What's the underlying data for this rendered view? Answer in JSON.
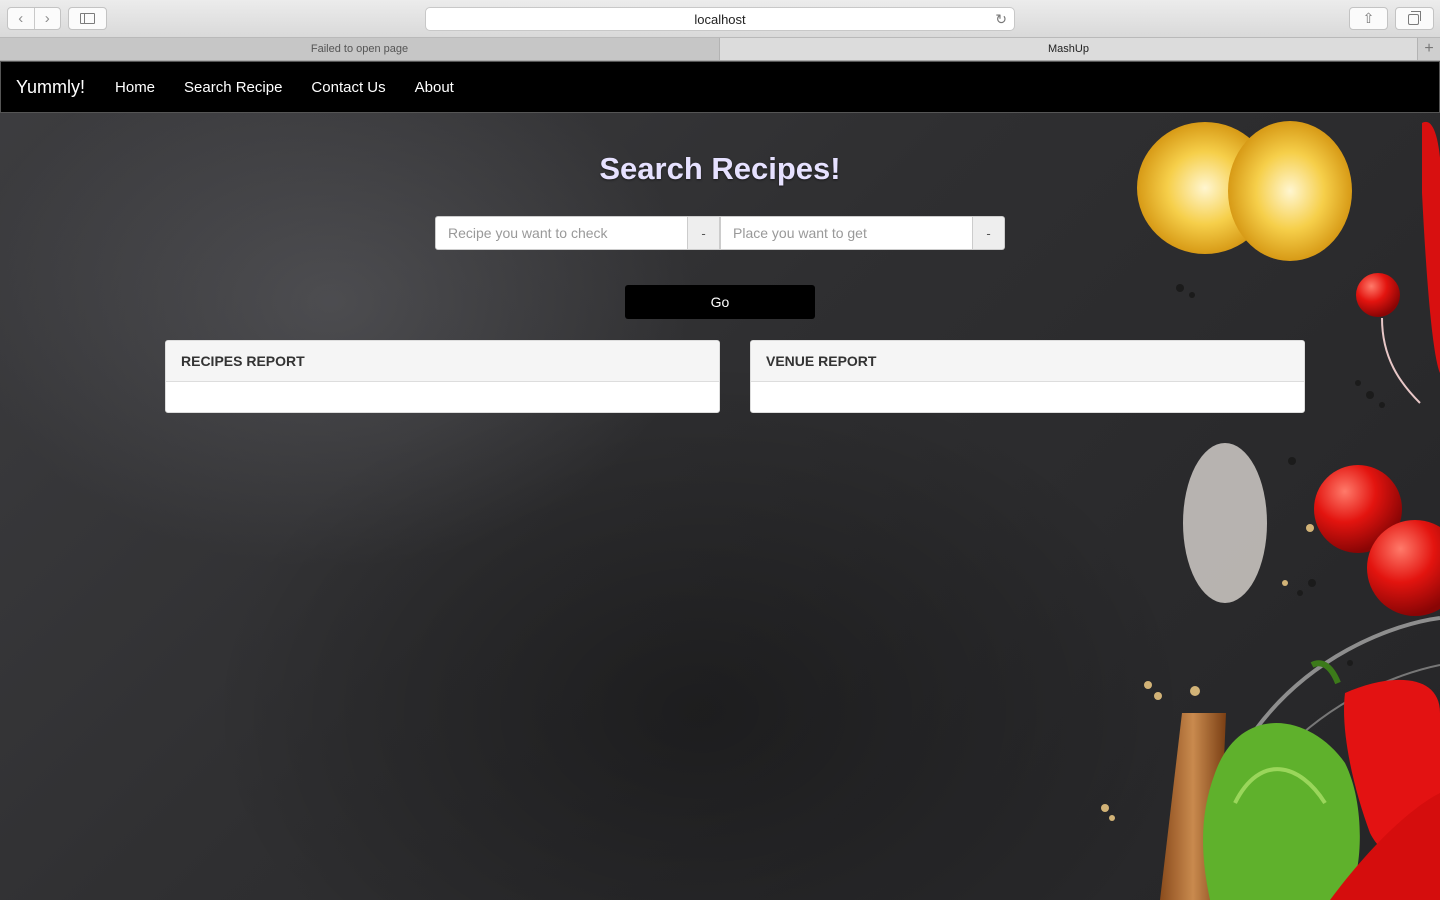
{
  "browser": {
    "url": "localhost",
    "tabs": [
      {
        "label": "Failed to open page"
      },
      {
        "label": "MashUp"
      }
    ]
  },
  "navbar": {
    "brand": "Yummly!",
    "links": [
      "Home",
      "Search Recipe",
      "Contact Us",
      "About"
    ]
  },
  "search": {
    "title": "Search Recipes!",
    "recipe_placeholder": "Recipe you want to check",
    "recipe_addon": "-",
    "place_placeholder": "Place you want to get",
    "place_addon": "-",
    "go_label": "Go"
  },
  "panels": {
    "recipes": "RECIPES REPORT",
    "venue": "VENUE REPORT"
  },
  "colors": {
    "navbar_bg": "#000000",
    "title_color": "#e6e1ff",
    "go_button_bg": "#000000"
  },
  "icons": [
    "back-arrow-icon",
    "forward-arrow-icon",
    "sidebar-icon",
    "reload-icon",
    "share-icon",
    "tabs-overview-icon",
    "new-tab-icon"
  ]
}
